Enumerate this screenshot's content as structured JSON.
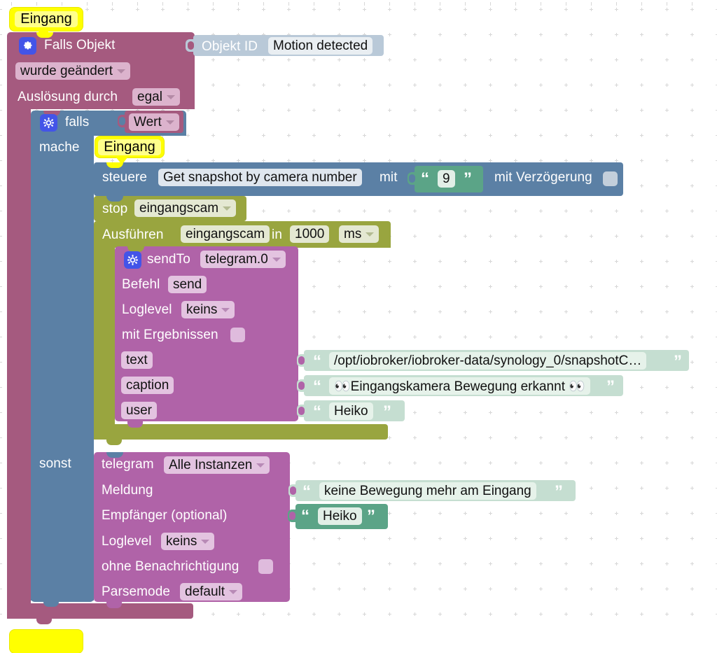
{
  "app": {
    "name": "ioBroker Blockly Script Editor",
    "canvas_background": "#ffffff",
    "grid_dot_color": "#d7d7d7"
  },
  "colors": {
    "trigger_plum": "#a55a7f",
    "logic_blue": "#5b80a5",
    "object_id_blue": "#b9c9d8",
    "timeouts_olive": "#99a53f",
    "sendto_purple": "#b063a8",
    "text_green_light": "#c5ded1",
    "text_green_dark": "#5ba487",
    "comment_yellow": "#ffff00",
    "gear_blue": "#4354e8"
  },
  "comments": [
    {
      "id": "comment-top",
      "text": "Eingang"
    },
    {
      "id": "comment-do",
      "text": "Eingang"
    }
  ],
  "trigger_block": {
    "name": "on-object-change",
    "icon": "gear-icon",
    "title": "Falls Objekt",
    "object_id_label": "Objekt ID",
    "object_id_value": "Motion detected",
    "condition_field": "wurde geändert",
    "trigger_by_label": "Auslösung durch",
    "trigger_by_value": "egal"
  },
  "if_block": {
    "name": "controls-if",
    "icon": "gear-icon",
    "if_label": "falls",
    "if_value": "Wert",
    "do_label": "mache",
    "else_label": "sonst"
  },
  "control_block": {
    "name": "control-state",
    "verb": "steuere",
    "target": "Get snapshot by camera number",
    "with_label": "mit",
    "value": "9",
    "delay_label": "mit Verzögerung",
    "delay_checked": false
  },
  "stop_block": {
    "name": "timeout-clear",
    "label": "stop",
    "timer": "eingangscam"
  },
  "timeout_block": {
    "name": "timeout-set",
    "label": "Ausführen",
    "timer": "eingangscam",
    "in_label": "in",
    "duration": "1000",
    "unit": "ms"
  },
  "sendto_block": {
    "name": "sendto-telegram",
    "icon": "gear-icon",
    "title": "sendTo",
    "instance": "telegram.0",
    "rows": [
      {
        "label": "Befehl",
        "value": "send",
        "kind": "text"
      },
      {
        "label": "Loglevel",
        "value": "keins",
        "kind": "dropdown"
      },
      {
        "label": "mit Ergebnissen",
        "value": "",
        "kind": "checkbox"
      }
    ],
    "args": [
      {
        "label": "text",
        "value": "/opt/iobroker/iobroker-data/synology_0/snapshotC…",
        "selected": false
      },
      {
        "label": "caption",
        "value": "👀Eingangskamera Bewegung erkannt 👀",
        "selected": false
      },
      {
        "label": "user",
        "value": "Heiko",
        "selected": false
      }
    ]
  },
  "telegram_block": {
    "name": "telegram-message",
    "title_label": "telegram",
    "instance": "Alle Instanzen",
    "message_label": "Meldung",
    "message_value": "keine Bewegung mehr am Eingang",
    "recipient_label": "Empfänger (optional)",
    "recipient_value": "Heiko",
    "loglevel_label": "Loglevel",
    "loglevel_value": "keins",
    "silent_label": "ohne Benachrichtigung",
    "silent_checked": false,
    "parsemode_label": "Parsemode",
    "parsemode_value": "default"
  }
}
